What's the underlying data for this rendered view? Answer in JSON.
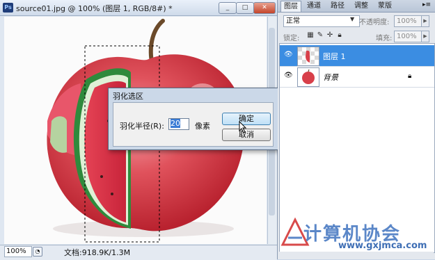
{
  "document": {
    "title": "source01.jpg @ 100% (图层 1, RGB/8#) *",
    "buttons": {
      "minimize": "_",
      "maximize": "□",
      "close": "✕"
    },
    "zoom": "100%",
    "doc_info": "文档:918.9K/1.3M"
  },
  "dialog": {
    "title": "羽化选区",
    "radius_label": "羽化半径(R):",
    "radius_value": "20",
    "unit": "像素",
    "ok_label": "确定",
    "cancel_label": "取消"
  },
  "panel": {
    "tabs": [
      "图层",
      "通道",
      "路径",
      "调整",
      "蒙版"
    ],
    "menu": "▸≡",
    "blend_mode": "正常",
    "opacity_label": "不透明度:",
    "opacity_value": "100%",
    "lock_label": "锁定:",
    "fill_label": "填充:",
    "fill_value": "100%",
    "layers": [
      {
        "name": "图层 1",
        "selected": true
      },
      {
        "name": "背景",
        "selected": false,
        "locked": true
      }
    ]
  },
  "watermark": {
    "text": "计算机协会",
    "url": "www.gxjmca.com"
  },
  "colors": {
    "accent": "#3b8de2",
    "apple_red": "#d8404a",
    "watermelon_green": "#2f8a3c"
  }
}
